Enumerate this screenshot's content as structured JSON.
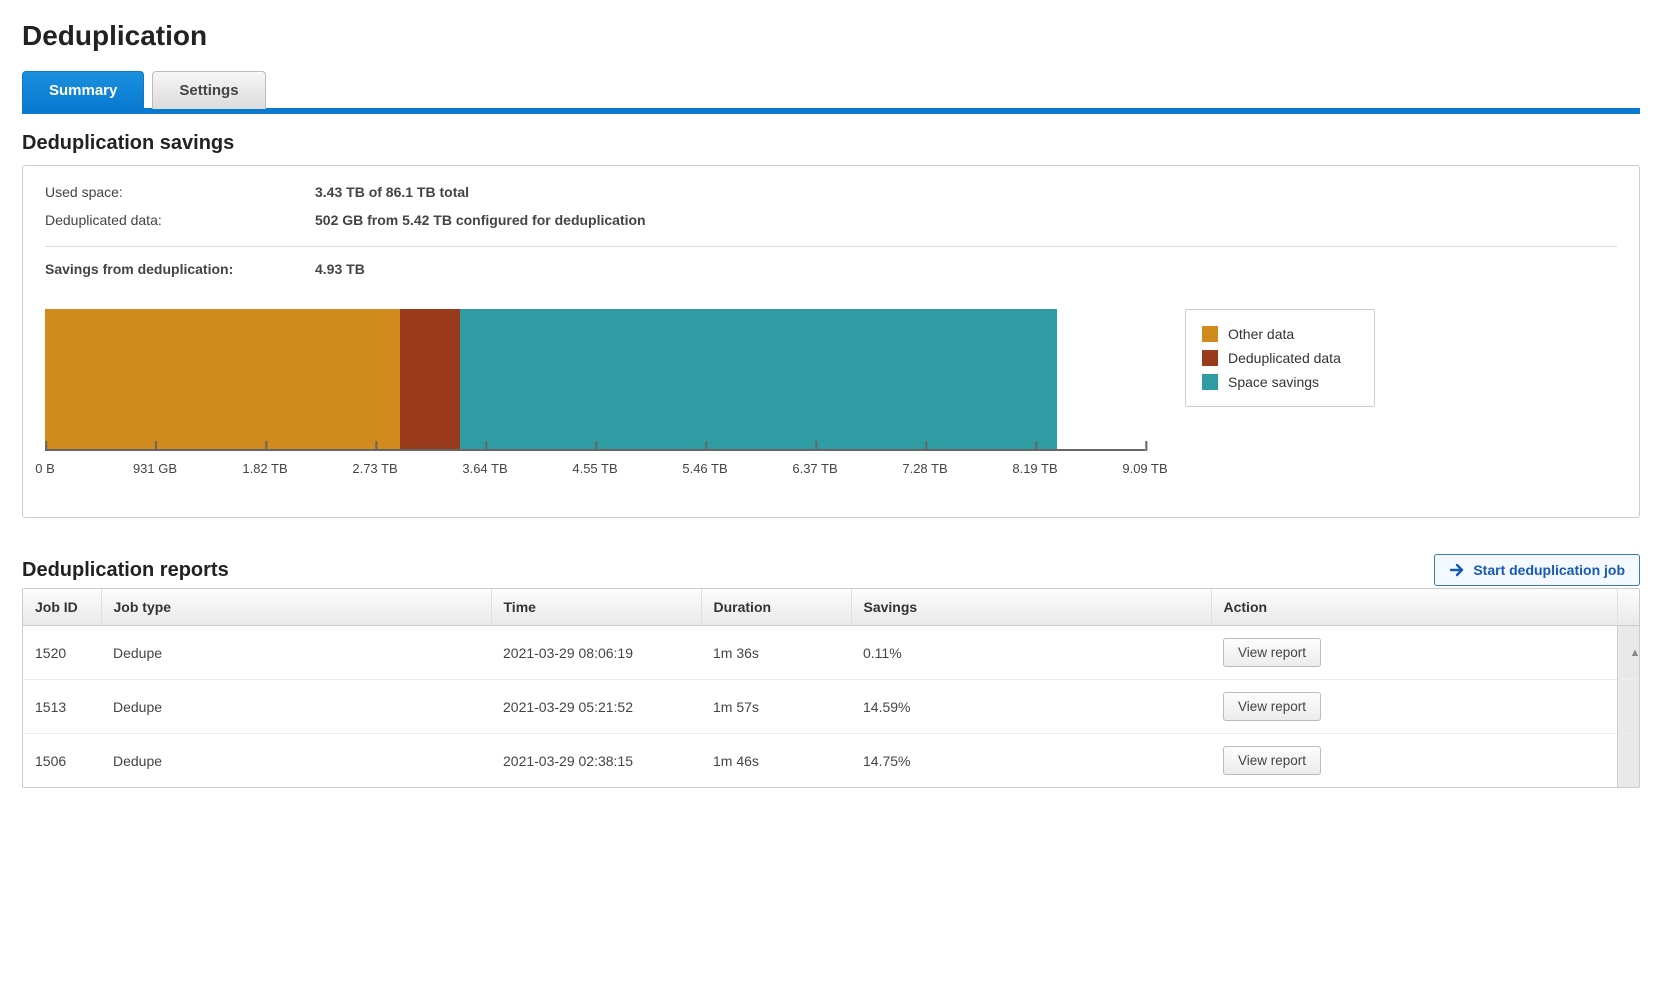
{
  "page": {
    "title": "Deduplication"
  },
  "tabs": {
    "summary": "Summary",
    "settings": "Settings"
  },
  "savings": {
    "heading": "Deduplication savings",
    "used_label": "Used space:",
    "used_value": "3.43 TB of 86.1 TB total",
    "dedup_label": "Deduplicated data:",
    "dedup_value": "502 GB from 5.42 TB configured for deduplication",
    "savings_label": "Savings from deduplication:",
    "savings_value": "4.93 TB"
  },
  "chart_data": {
    "type": "bar",
    "orientation": "horizontal-stacked",
    "title": "",
    "xlabel": "",
    "ylabel": "",
    "xlim": [
      0,
      9.09
    ],
    "x_ticks": [
      "0 B",
      "931 GB",
      "1.82 TB",
      "2.73 TB",
      "3.64 TB",
      "4.55 TB",
      "5.46 TB",
      "6.37 TB",
      "7.28 TB",
      "8.19 TB",
      "9.09 TB"
    ],
    "series": [
      {
        "name": "Other data",
        "value_tb": 2.93,
        "color": "#d08b1c"
      },
      {
        "name": "Deduplicated data",
        "value_tb": 0.5,
        "color": "#9a3a1c"
      },
      {
        "name": "Space savings",
        "value_tb": 4.93,
        "color": "#2f9ba2"
      }
    ],
    "total_tb": 8.36
  },
  "legend": {
    "other": "Other data",
    "dedup": "Deduplicated data",
    "savings": "Space savings"
  },
  "reports": {
    "heading": "Deduplication reports",
    "start_button": "Start deduplication job",
    "columns": {
      "job_id": "Job ID",
      "job_type": "Job type",
      "time": "Time",
      "duration": "Duration",
      "savings": "Savings",
      "action": "Action"
    },
    "view_label": "View report",
    "rows": [
      {
        "job_id": "1520",
        "job_type": "Dedupe",
        "time": "2021-03-29 08:06:19",
        "duration": "1m 36s",
        "savings": "0.11%"
      },
      {
        "job_id": "1513",
        "job_type": "Dedupe",
        "time": "2021-03-29 05:21:52",
        "duration": "1m 57s",
        "savings": "14.59%"
      },
      {
        "job_id": "1506",
        "job_type": "Dedupe",
        "time": "2021-03-29 02:38:15",
        "duration": "1m 46s",
        "savings": "14.75%"
      }
    ]
  }
}
